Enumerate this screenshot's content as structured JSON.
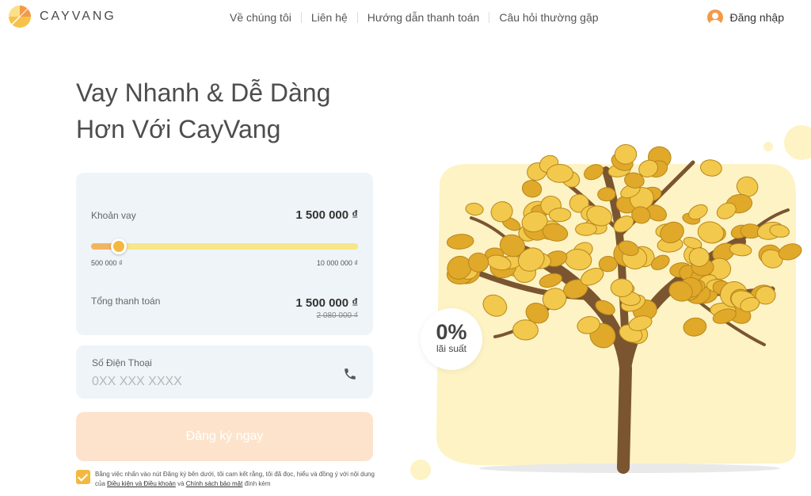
{
  "header": {
    "brand": "CAYVANG",
    "nav": [
      "Về chúng tôi",
      "Liên hệ",
      "Hướng dẫn thanh toán",
      "Câu hỏi thường gặp"
    ],
    "login_label": "Đăng nhập"
  },
  "hero": {
    "title_line1": "Vay Nhanh & Dễ Dàng",
    "title_line2": "Hơn Với CayVang"
  },
  "loan": {
    "amount_label": "Khoản vay",
    "amount_value": "1 500 000 ₫",
    "slider_min_label": "500 000 ₫",
    "slider_max_label": "10 000 000 ₫",
    "slider_value": 1500000,
    "slider_min": 500000,
    "slider_max": 10000000,
    "total_label": "Tổng thanh toán",
    "total_value": "1 500 000 ₫",
    "total_original": "2 080 000 ₫"
  },
  "phone": {
    "label": "Số Điện Thoại",
    "placeholder": "0XX XXX XXXX",
    "value": ""
  },
  "submit_label": "Đăng ký ngay",
  "terms": {
    "checked": true,
    "text_before": "Bằng việc nhấn vào nút Đăng ký bên dưới, tôi cam kết rằng, tôi đã đọc, hiểu và đồng ý với nội dung của ",
    "link1": "Điều kiện và Điều khoản",
    "text_middle": " và ",
    "link2": "Chính sách bảo mật",
    "text_after": " đính kèm"
  },
  "badge": {
    "percent": "0%",
    "caption": "lãi suất"
  },
  "colors": {
    "accent": "#f3b93f",
    "slider_track": "#f7e68a",
    "card_bg": "#eef4f8",
    "button_bg": "#fde3cc",
    "art_bg": "#fdf3c4"
  }
}
